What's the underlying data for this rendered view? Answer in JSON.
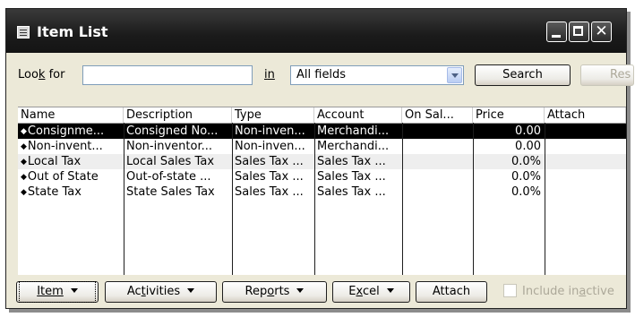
{
  "window": {
    "title": "Item List",
    "close_symbol": "✕"
  },
  "search": {
    "look_for_prefix": "Loo",
    "look_for_underlined": "k",
    "look_for_suffix": " for",
    "input_value": "",
    "in_label_underlined": "i",
    "in_label_rest": "n",
    "field_select_value": "All fields",
    "search_button": "Search",
    "reset_button": "Res"
  },
  "table": {
    "columns": [
      "Name",
      "Description",
      "Type",
      "Account",
      "On Sal...",
      "Price",
      "Attach"
    ],
    "rows": [
      {
        "name": "Consignme...",
        "description": "Consigned No...",
        "type": "Non-inven...",
        "account": "Merchandi...",
        "on_sale": "",
        "price": "0.00",
        "attach": "",
        "selected": true
      },
      {
        "name": "Non-invent...",
        "description": "Non-inventor...",
        "type": "Non-inven...",
        "account": "Merchandi...",
        "on_sale": "",
        "price": "0.00",
        "attach": "",
        "selected": false
      },
      {
        "name": "Local Tax",
        "description": "Local Sales Tax",
        "type": "Sales Tax ...",
        "account": "Sales Tax ...",
        "on_sale": "",
        "price": "0.0%",
        "attach": "",
        "selected": false
      },
      {
        "name": "Out of State",
        "description": "Out-of-state ...",
        "type": "Sales Tax ...",
        "account": "Sales Tax ...",
        "on_sale": "",
        "price": "0.0%",
        "attach": "",
        "selected": false
      },
      {
        "name": "State Tax",
        "description": "State Sales Tax",
        "type": "Sales Tax ...",
        "account": "Sales Tax ...",
        "on_sale": "",
        "price": "0.0%",
        "attach": "",
        "selected": false
      }
    ]
  },
  "bottom": {
    "item_u": "I",
    "item_rest": "tem",
    "activities_a": "Ac",
    "activities_u": "t",
    "activities_b": "ivities",
    "reports_a": "Rep",
    "reports_u": "o",
    "reports_b": "rts",
    "excel_a": "E",
    "excel_u": "x",
    "excel_b": "cel",
    "attach": "Attach",
    "include_a": "Include in",
    "include_u": "a",
    "include_b": "ctive",
    "include_inactive_checked": false
  }
}
